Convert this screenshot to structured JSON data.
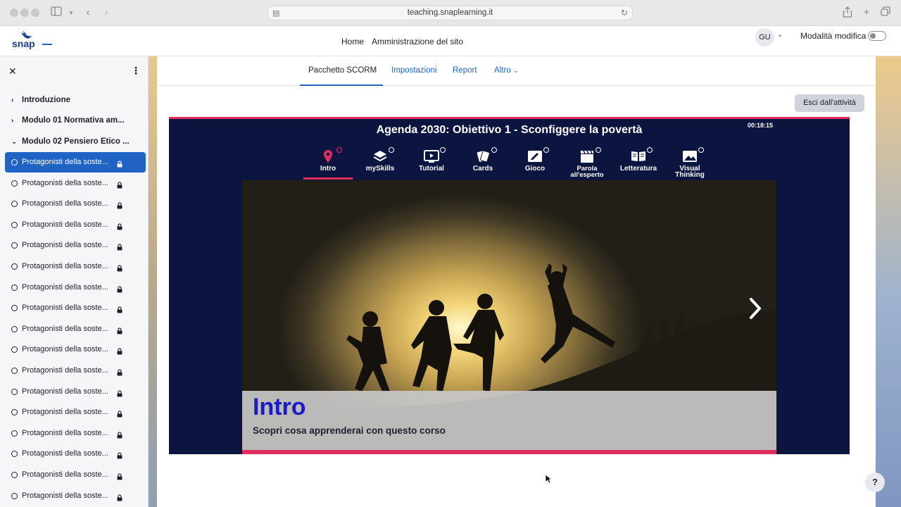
{
  "browser": {
    "url": "teaching.snaplearning.it"
  },
  "navbar": {
    "logo_text": "snap",
    "links": [
      "Home",
      "Amministrazione del sito"
    ],
    "user_initials": "GU",
    "edit_mode_label": "Modalità modifica",
    "edit_mode_on": false
  },
  "sidebar": {
    "sections": [
      {
        "label": "Introduzione",
        "expanded": false
      },
      {
        "label": "Modulo 01 Normativa am...",
        "expanded": false
      },
      {
        "label": "Modulo 02 Pensiero Etico ...",
        "expanded": true
      }
    ],
    "items": [
      {
        "label": "Protagonisti della soste...",
        "active": true
      },
      {
        "label": "Protagonisti della soste...",
        "active": false
      },
      {
        "label": "Protagonisti della soste...",
        "active": false
      },
      {
        "label": "Protagonisti della soste...",
        "active": false
      },
      {
        "label": "Protagonisti della soste...",
        "active": false
      },
      {
        "label": "Protagonisti della soste...",
        "active": false
      },
      {
        "label": "Protagonisti della soste...",
        "active": false
      },
      {
        "label": "Protagonisti della soste...",
        "active": false
      },
      {
        "label": "Protagonisti della soste...",
        "active": false
      },
      {
        "label": "Protagonisti della soste...",
        "active": false
      },
      {
        "label": "Protagonisti della soste...",
        "active": false
      },
      {
        "label": "Protagonisti della soste...",
        "active": false
      },
      {
        "label": "Protagonisti della soste...",
        "active": false
      },
      {
        "label": "Protagonisti della soste...",
        "active": false
      },
      {
        "label": "Protagonisti della soste...",
        "active": false
      },
      {
        "label": "Protagonisti della soste...",
        "active": false
      },
      {
        "label": "Protagonisti della soste...",
        "active": false
      }
    ]
  },
  "tabs": [
    {
      "label": "Pacchetto SCORM",
      "current": true
    },
    {
      "label": "Impostazioni",
      "current": false
    },
    {
      "label": "Report",
      "current": false
    },
    {
      "label": "Altro",
      "current": false
    }
  ],
  "exit_button": "Esci dall'attività",
  "player": {
    "title": "Agenda 2030: Obiettivo 1 - Sconfiggere la povertà",
    "timer": "00:18:15",
    "nav": [
      {
        "label": "Intro",
        "icon": "location-pin-icon"
      },
      {
        "label": "mySkills",
        "icon": "layers-icon"
      },
      {
        "label": "Tutorial",
        "icon": "video-play-icon"
      },
      {
        "label": "Cards",
        "icon": "cards-icon"
      },
      {
        "label": "Gioco",
        "icon": "pencil-board-icon"
      },
      {
        "label": "Parola all'esperto",
        "icon": "clapperboard-icon"
      },
      {
        "label": "Letteratura",
        "icon": "open-book-icon"
      },
      {
        "label": "Visual Thinking",
        "icon": "image-icon"
      }
    ],
    "slide": {
      "title": "Intro",
      "subtitle": "Scopri cosa apprenderai con questo corso"
    }
  },
  "help_label": "?",
  "colors": {
    "accent_blue": "#1f64c4",
    "player_bg": "#0c1440",
    "player_accent": "#e02d5f",
    "slide_title": "#1a1ac8"
  }
}
